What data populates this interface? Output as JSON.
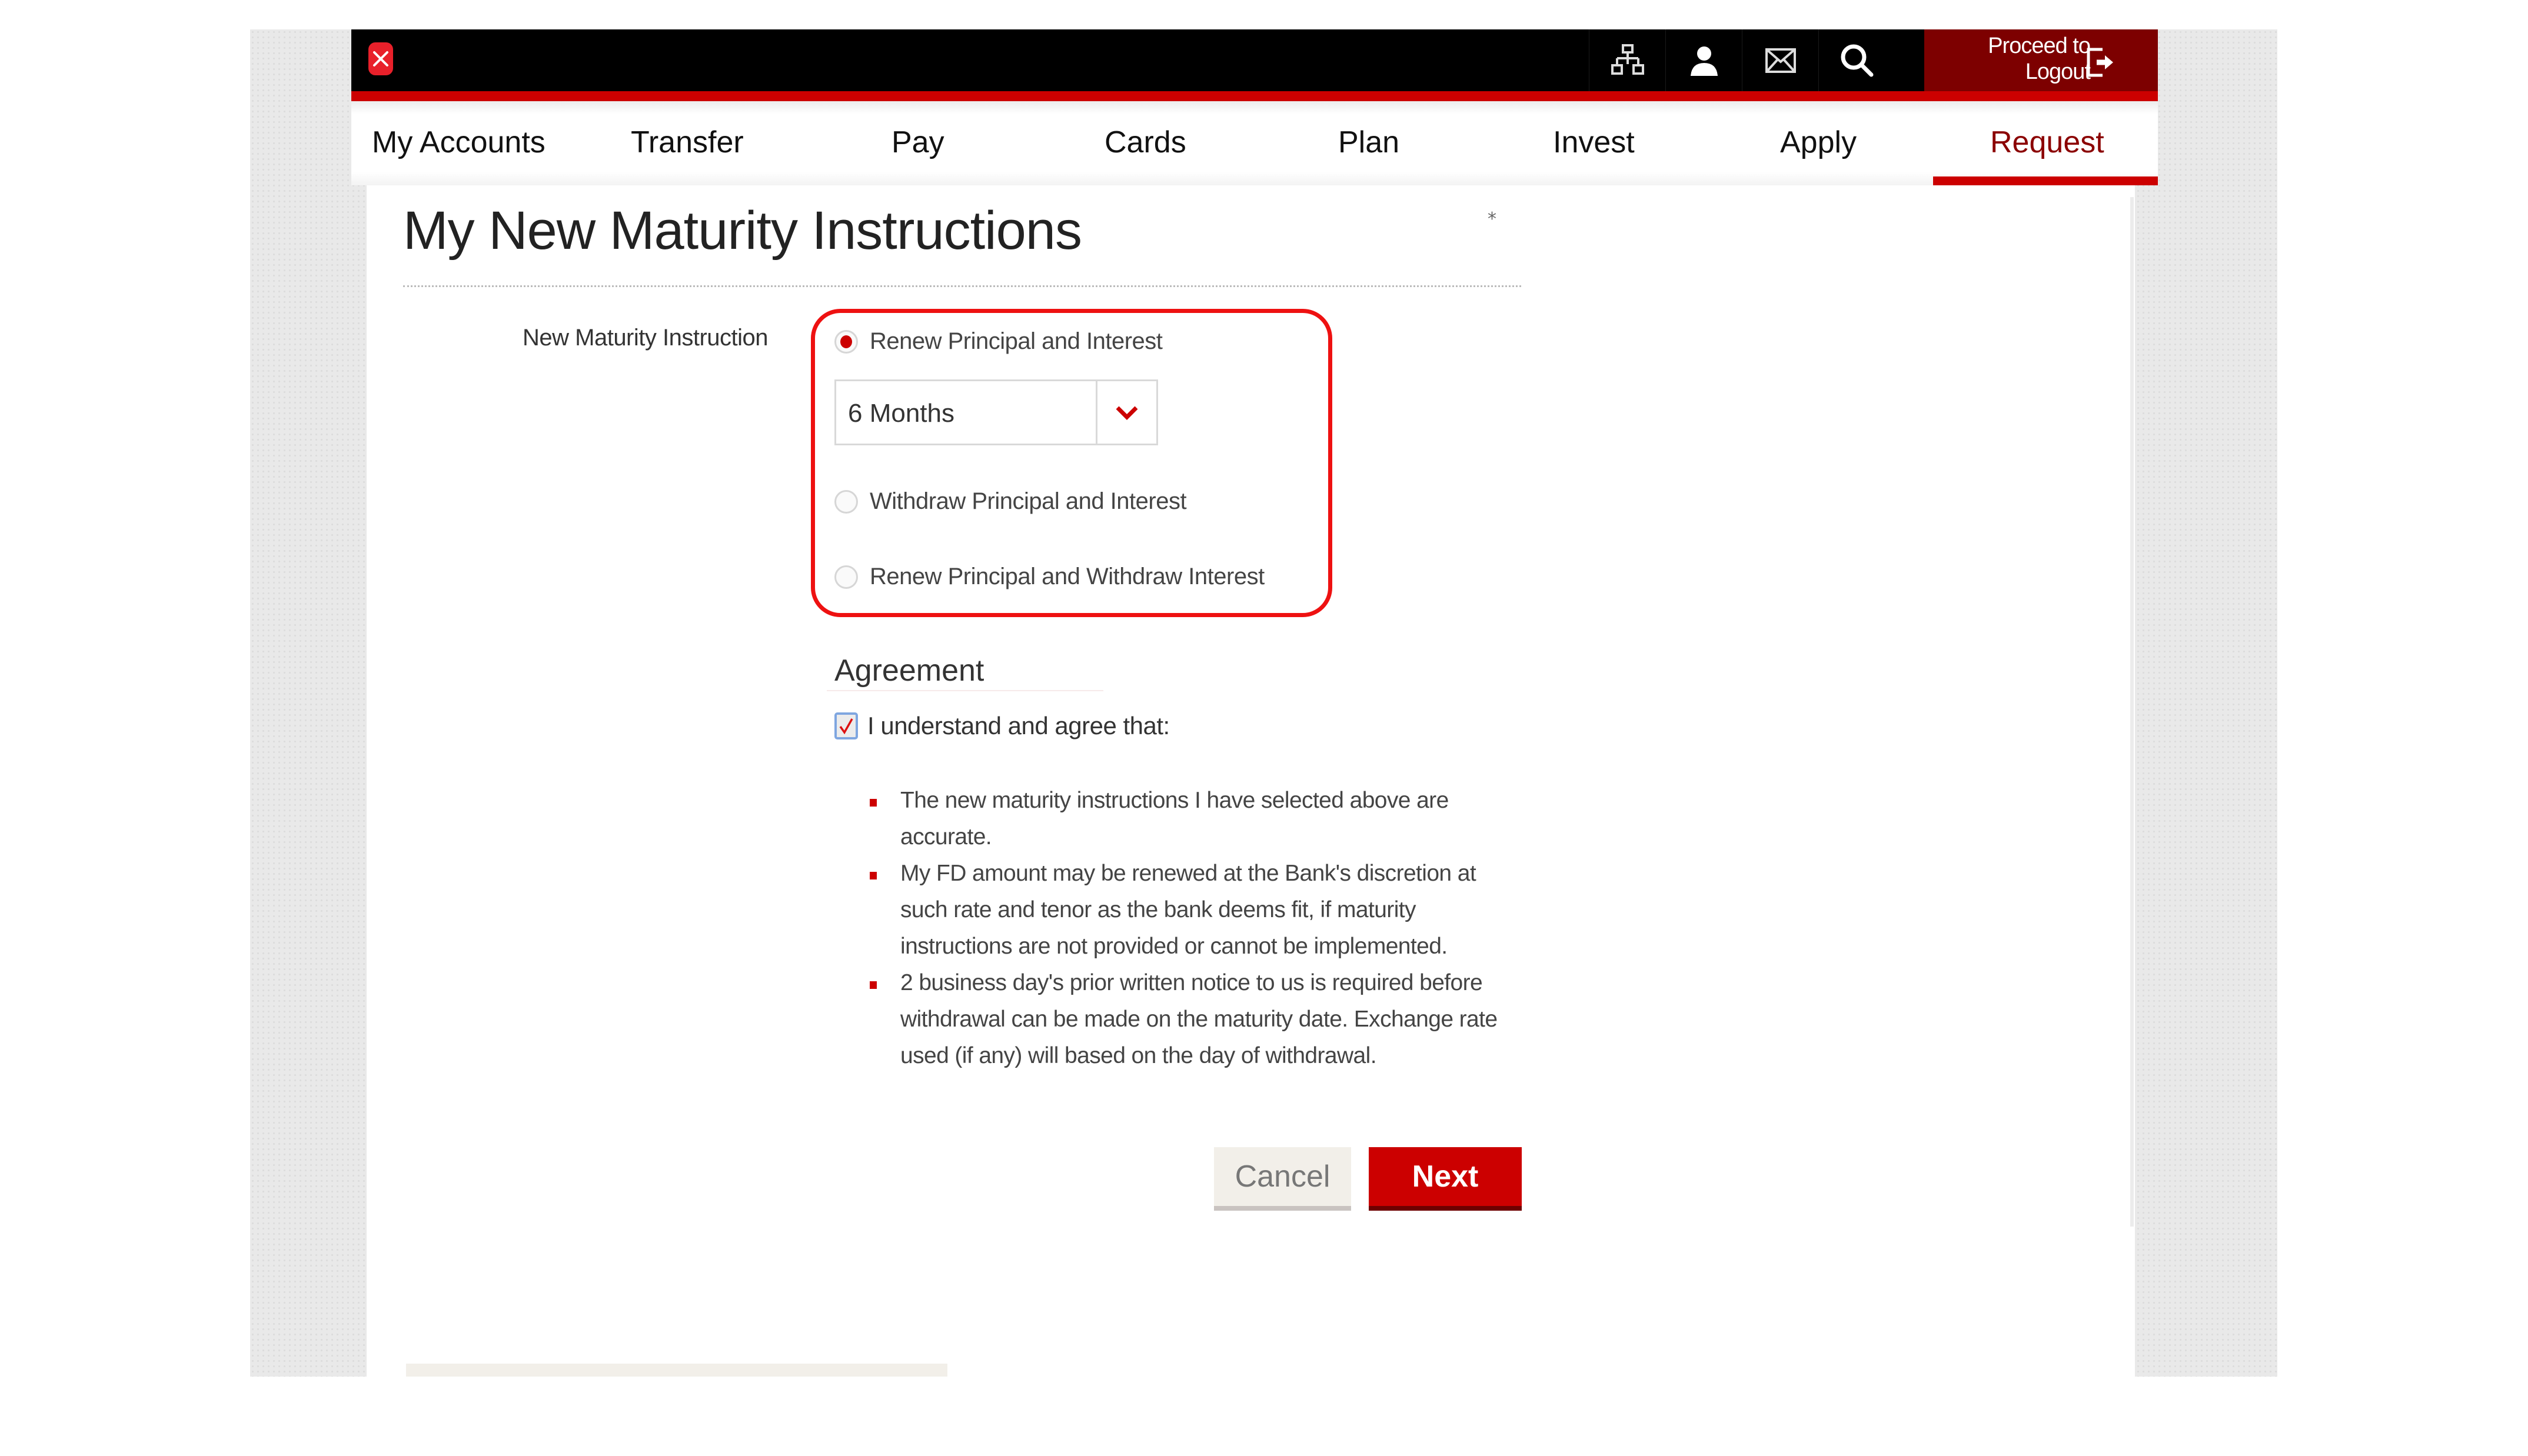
{
  "header": {
    "logo": "dbs-logo",
    "icons": [
      {
        "name": "sitemap-icon",
        "label": "Sitemap"
      },
      {
        "name": "profile-icon",
        "label": "Profile"
      },
      {
        "name": "mail-icon",
        "label": "Mailbox"
      },
      {
        "name": "search-icon",
        "label": "Search"
      }
    ],
    "logout_label_line1": "Proceed to",
    "logout_label_line2": "Logout"
  },
  "nav": {
    "items": [
      {
        "label": "My Accounts"
      },
      {
        "label": "Transfer"
      },
      {
        "label": "Pay"
      },
      {
        "label": "Cards"
      },
      {
        "label": "Plan"
      },
      {
        "label": "Invest"
      },
      {
        "label": "Apply"
      },
      {
        "label": "Request",
        "active": true
      }
    ]
  },
  "page": {
    "title": "My New Maturity Instructions",
    "required_marker": "*"
  },
  "form": {
    "field_label": "New Maturity Instruction",
    "options": [
      {
        "label": "Renew Principal and Interest",
        "selected": true
      },
      {
        "label": "Withdraw Principal and Interest",
        "selected": false
      },
      {
        "label": "Renew Principal and Withdraw Interest",
        "selected": false
      }
    ],
    "tenor_select": {
      "value": "6 Months"
    }
  },
  "agreement": {
    "title": "Agreement",
    "checkbox_label": "I understand and agree that:",
    "checked": true,
    "terms": [
      "The new maturity instructions I have selected above are accurate.",
      "My FD amount may be renewed at the Bank's discretion at such rate and tenor as the bank deems fit, if maturity instructions are not provided or cannot be implemented.",
      "2 business day's prior written notice to us is required before withdrawal can be made on the maturity date. Exchange rate used (if any) will based on the day of withdrawal."
    ]
  },
  "actions": {
    "cancel_label": "Cancel",
    "next_label": "Next"
  },
  "colors": {
    "brand_red": "#cc0000",
    "logout_bg": "#7d0000",
    "highlight": "#ee1111",
    "header_bg": "#000000"
  }
}
